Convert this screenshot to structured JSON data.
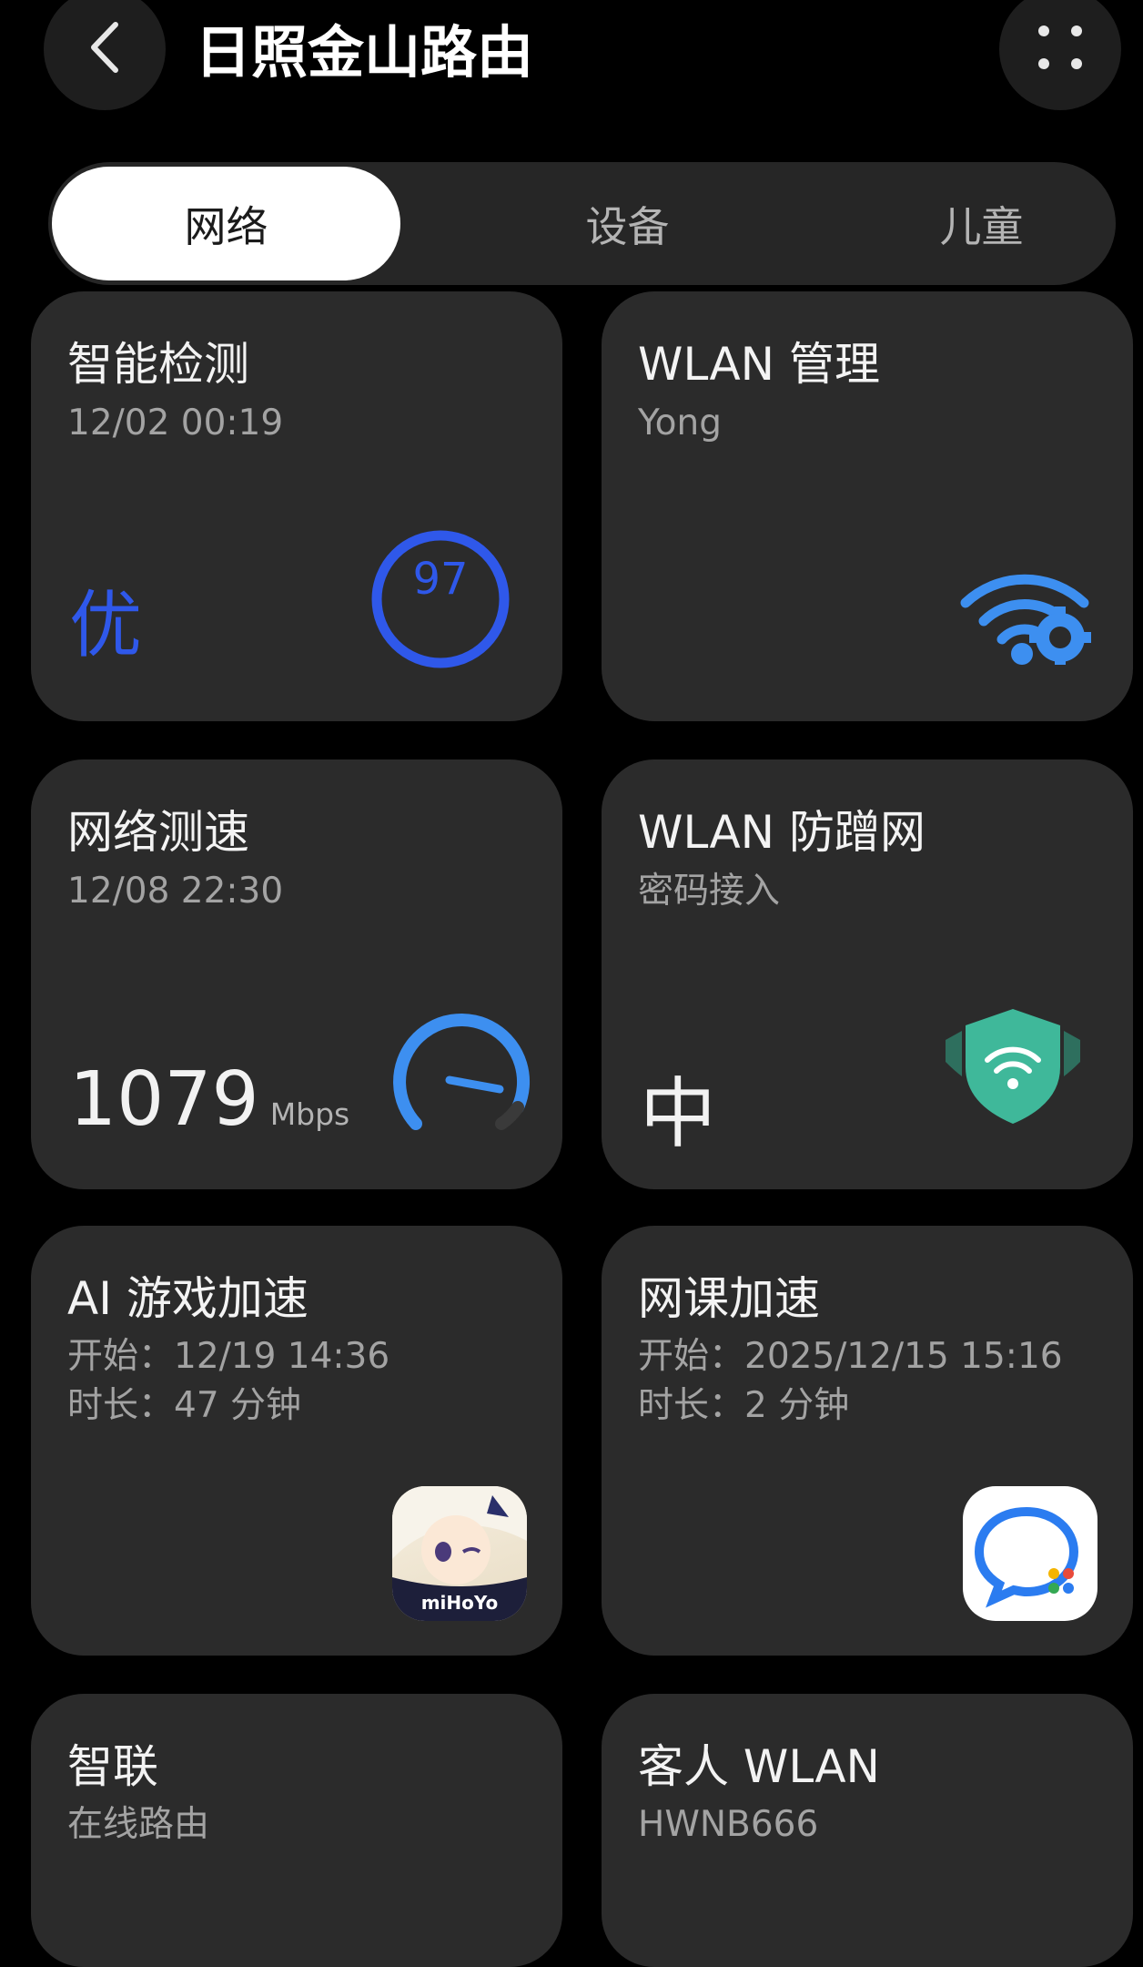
{
  "header": {
    "title": "日照金山路由",
    "back_icon": "chevron-left-icon",
    "more_icon": "grid-dots-icon"
  },
  "tabs": [
    {
      "label": "网络",
      "active": true
    },
    {
      "label": "设备",
      "active": false
    },
    {
      "label": "儿童",
      "active": false
    }
  ],
  "cards": {
    "detect": {
      "title": "智能检测",
      "time": "12/02 00:19",
      "grade": "优",
      "score": "97"
    },
    "wlan_manage": {
      "title": "WLAN 管理",
      "ssid": "Yong",
      "icon": "wifi-settings-icon"
    },
    "speedtest": {
      "title": "网络测速",
      "time": "12/08 22:30",
      "speed": "1079",
      "unit": "Mbps",
      "icon": "speedometer-icon"
    },
    "anti_leech": {
      "title": "WLAN 防蹭网",
      "mode": "密码接入",
      "level": "中",
      "icon": "wifi-shield-icon"
    },
    "game_boost": {
      "title": "AI 游戏加速",
      "start": "开始：12/19 14:36",
      "duration": "时长：47 分钟",
      "app_label": "miHoYo"
    },
    "class_boost": {
      "title": "网课加速",
      "start": "开始：2025/12/15 15:16",
      "duration": "时长：2 分钟",
      "icon": "chat-bubble-app-icon"
    },
    "smart_link": {
      "title": "智联",
      "sub": "在线路由"
    },
    "guest_wlan": {
      "title": "客人 WLAN",
      "ssid": "HWNB666"
    }
  },
  "colors": {
    "accent_blue": "#2f58ea",
    "card_bg": "#2b2b2b",
    "shield_green": "#3fb89a"
  }
}
